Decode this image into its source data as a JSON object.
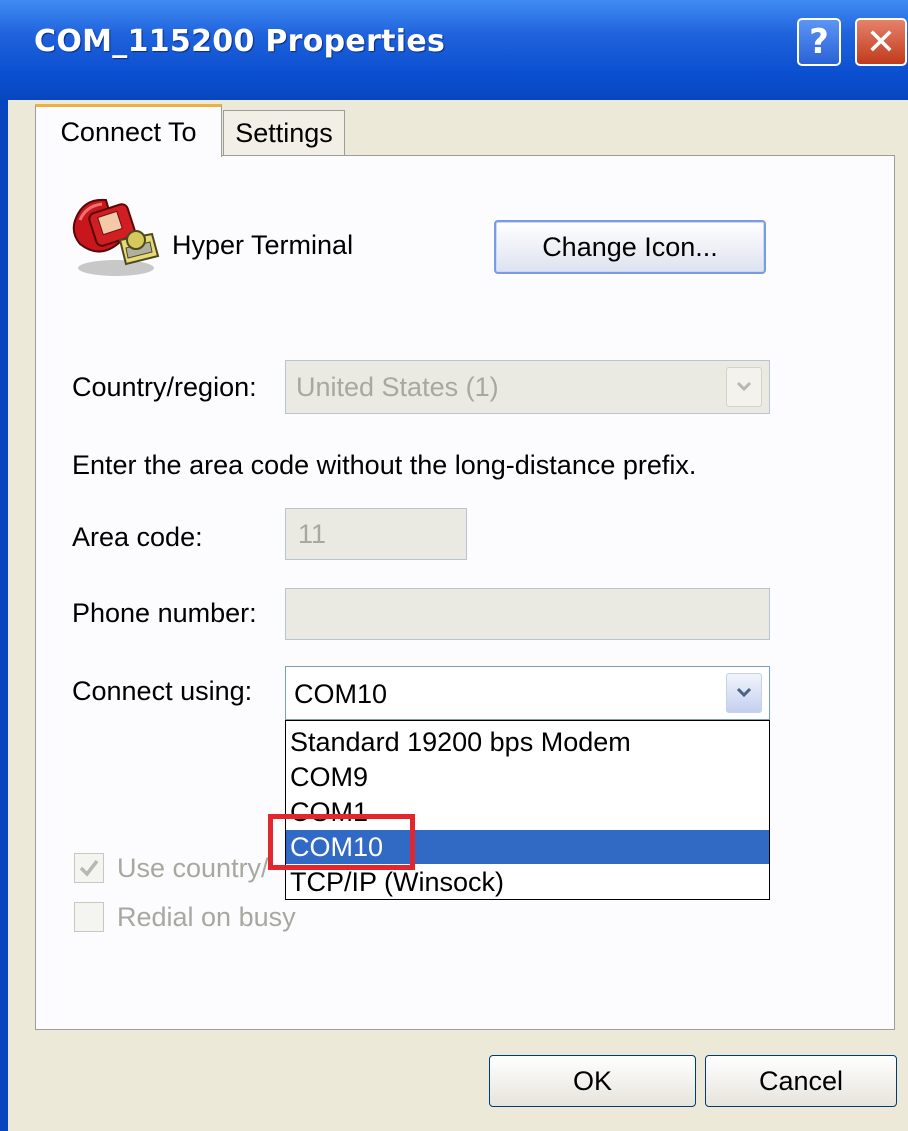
{
  "window": {
    "title": "COM_115200 Properties",
    "help_glyph": "?",
    "close_glyph": "✕"
  },
  "tabs": [
    {
      "label": "Connect To",
      "active": true
    },
    {
      "label": "Settings",
      "active": false
    }
  ],
  "connection": {
    "name": "Hyper Terminal",
    "icon": "hyperterminal-phone-icon",
    "change_icon_label": "Change Icon..."
  },
  "country": {
    "label": "Country/region:",
    "value": "United States (1)"
  },
  "instruction": "Enter the area code without the long-distance prefix.",
  "area_code": {
    "label": "Area code:",
    "value": "11"
  },
  "phone": {
    "label": "Phone number:",
    "value": ""
  },
  "connect_using": {
    "label": "Connect using:",
    "value": "COM10",
    "options": [
      "Standard 19200 bps Modem",
      "COM9",
      "COM1",
      "COM10",
      "TCP/IP (Winsock)"
    ],
    "selected_index": 3
  },
  "checkboxes": {
    "use_country": "Use country/",
    "redial": "Redial on busy"
  },
  "buttons": {
    "ok": "OK",
    "cancel": "Cancel"
  },
  "colors": {
    "titlebar": "#0a4fd0",
    "selection": "#316ac5",
    "highlight_box": "#e3262d"
  }
}
